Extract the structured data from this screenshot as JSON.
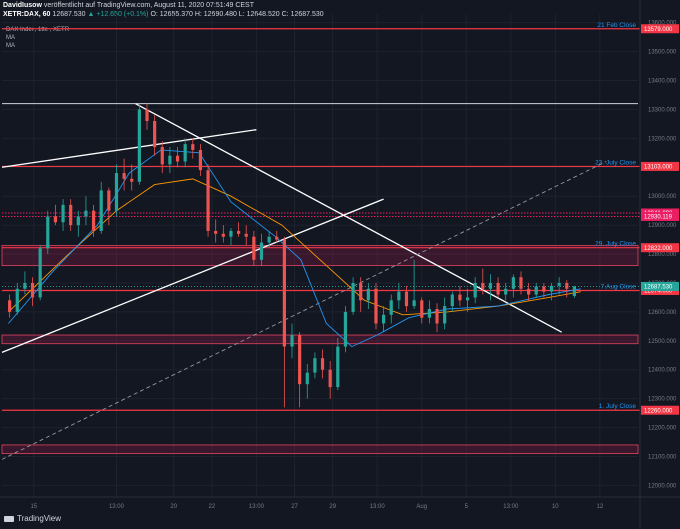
{
  "header": {
    "author": "DavidIusow",
    "published": "veröffentlicht auf TradingView.com, August 11, 2020 07:51:49 CEST",
    "symbol": "XETR:DAX, 60",
    "last": "12687.530",
    "change": "▲ +12.650 (+0.1%)",
    "ohlc": "O: 12655.370 H: 12690.480 L: 12648.520 C: 12687.530"
  },
  "legend": {
    "title": "DAX Index, 1tte , XETR",
    "ma1": "MA",
    "ma2": "MA"
  },
  "branding": {
    "name": "TradingView"
  },
  "chart_data": {
    "type": "candlestick",
    "ylim": [
      11960,
      13630
    ],
    "y_ticks": [
      12000,
      12100,
      12200,
      12300,
      12400,
      12500,
      12600,
      12700,
      12800,
      12900,
      13000,
      13100,
      13200,
      13300,
      13400,
      13500,
      13600
    ],
    "y_tick_labels": [
      "12000.000",
      "12100.000",
      "12200.000",
      "12300.000",
      "12400.000",
      "12500.000",
      "12600.000",
      "12700.000",
      "12800.000",
      "12900.000",
      "13000.000",
      "13100.000",
      "13200.000",
      "13300.000",
      "13400.000",
      "13500.000",
      "13600.000"
    ],
    "xlim": [
      0,
      100
    ],
    "x_ticks": [
      5,
      18,
      27,
      33,
      40,
      46,
      52,
      59,
      66,
      73,
      80,
      87,
      94
    ],
    "x_tick_labels": [
      "15",
      "13:00",
      "20",
      "22",
      "13:00",
      "27",
      "29",
      "13:00",
      "Aug",
      "5",
      "13:00",
      "10",
      "12"
    ],
    "bars_x": [
      1.2,
      2.4,
      3.6,
      4.8,
      6,
      7.2,
      8.4,
      9.6,
      10.8,
      12,
      13.2,
      14.4,
      15.6,
      16.8,
      18,
      19.2,
      20.4,
      21.6,
      22.8,
      24,
      25.2,
      26.4,
      27.6,
      28.8,
      30,
      31.2,
      32.4,
      33.6,
      34.8,
      36,
      37.2,
      38.4,
      39.6,
      40.8,
      42,
      43.2,
      44.4,
      45.6,
      46.8,
      48,
      49.2,
      50.4,
      51.6,
      52.8,
      54,
      55.2,
      56.4,
      57.6,
      58.8,
      60,
      61.2,
      62.4,
      63.6,
      64.8,
      66,
      67.2,
      68.4,
      69.6,
      70.8,
      72,
      73.2,
      74.4,
      75.6,
      76.8,
      78,
      79.2,
      80.4,
      81.6,
      82.8,
      84,
      85.2,
      86.4,
      87.6,
      88.8,
      90,
      91.2
    ],
    "ohlc": [
      [
        12640,
        12660,
        12580,
        12600
      ],
      [
        12600,
        12700,
        12590,
        12680
      ],
      [
        12680,
        12740,
        12660,
        12700
      ],
      [
        12700,
        12720,
        12620,
        12650
      ],
      [
        12650,
        12830,
        12640,
        12820
      ],
      [
        12820,
        12950,
        12800,
        12930
      ],
      [
        12930,
        12970,
        12900,
        12910
      ],
      [
        12910,
        12990,
        12880,
        12970
      ],
      [
        12970,
        12990,
        12880,
        12900
      ],
      [
        12900,
        12950,
        12860,
        12930
      ],
      [
        12930,
        13000,
        12900,
        12950
      ],
      [
        12950,
        12970,
        12860,
        12880
      ],
      [
        12880,
        13050,
        12870,
        13020
      ],
      [
        13020,
        13030,
        12900,
        12950
      ],
      [
        12950,
        13110,
        12930,
        13080
      ],
      [
        13080,
        13130,
        13020,
        13060
      ],
      [
        13060,
        13110,
        13020,
        13050
      ],
      [
        13050,
        13320,
        13040,
        13300
      ],
      [
        13300,
        13320,
        13230,
        13260
      ],
      [
        13260,
        13280,
        13140,
        13170
      ],
      [
        13170,
        13190,
        13080,
        13110
      ],
      [
        13110,
        13170,
        13080,
        13140
      ],
      [
        13140,
        13170,
        13100,
        13120
      ],
      [
        13120,
        13200,
        13100,
        13180
      ],
      [
        13180,
        13200,
        13130,
        13160
      ],
      [
        13160,
        13180,
        13070,
        13090
      ],
      [
        13090,
        13110,
        12860,
        12880
      ],
      [
        12880,
        12920,
        12840,
        12870
      ],
      [
        12870,
        12900,
        12840,
        12860
      ],
      [
        12860,
        12890,
        12830,
        12880
      ],
      [
        12880,
        12910,
        12860,
        12870
      ],
      [
        12870,
        12900,
        12830,
        12860
      ],
      [
        12860,
        12880,
        12760,
        12780
      ],
      [
        12780,
        12870,
        12760,
        12840
      ],
      [
        12840,
        12880,
        12820,
        12860
      ],
      [
        12860,
        12880,
        12840,
        12850
      ],
      [
        12850,
        12860,
        12270,
        12480
      ],
      [
        12480,
        12560,
        12440,
        12520
      ],
      [
        12520,
        12530,
        12270,
        12350
      ],
      [
        12350,
        12420,
        12300,
        12390
      ],
      [
        12390,
        12460,
        12370,
        12440
      ],
      [
        12440,
        12470,
        12370,
        12400
      ],
      [
        12400,
        12430,
        12300,
        12340
      ],
      [
        12340,
        12510,
        12330,
        12480
      ],
      [
        12480,
        12620,
        12460,
        12600
      ],
      [
        12600,
        12720,
        12590,
        12700
      ],
      [
        12700,
        12720,
        12600,
        12640
      ],
      [
        12640,
        12700,
        12610,
        12680
      ],
      [
        12680,
        12700,
        12540,
        12560
      ],
      [
        12560,
        12620,
        12530,
        12590
      ],
      [
        12590,
        12660,
        12560,
        12640
      ],
      [
        12640,
        12700,
        12610,
        12670
      ],
      [
        12670,
        12690,
        12600,
        12620
      ],
      [
        12620,
        12780,
        12610,
        12640
      ],
      [
        12640,
        12650,
        12560,
        12580
      ],
      [
        12580,
        12640,
        12560,
        12610
      ],
      [
        12610,
        12630,
        12530,
        12560
      ],
      [
        12560,
        12650,
        12540,
        12620
      ],
      [
        12620,
        12670,
        12600,
        12660
      ],
      [
        12660,
        12690,
        12620,
        12640
      ],
      [
        12640,
        12680,
        12600,
        12650
      ],
      [
        12650,
        12720,
        12630,
        12700
      ],
      [
        12700,
        12750,
        12660,
        12680
      ],
      [
        12680,
        12730,
        12640,
        12700
      ],
      [
        12700,
        12720,
        12650,
        12660
      ],
      [
        12660,
        12700,
        12640,
        12680
      ],
      [
        12680,
        12730,
        12650,
        12720
      ],
      [
        12720,
        12740,
        12660,
        12680
      ],
      [
        12680,
        12700,
        12640,
        12660
      ],
      [
        12660,
        12700,
        12648,
        12688
      ],
      [
        12688,
        12700,
        12650,
        12670
      ],
      [
        12670,
        12700,
        12640,
        12690
      ],
      [
        12690,
        12720,
        12660,
        12700
      ],
      [
        12700,
        12710,
        12650,
        12680
      ],
      [
        12655,
        12690,
        12648,
        12688
      ]
    ],
    "ma_fast": [
      [
        1,
        12560
      ],
      [
        8,
        12740
      ],
      [
        15,
        12900
      ],
      [
        20,
        13080
      ],
      [
        25,
        13160
      ],
      [
        31,
        13150
      ],
      [
        36,
        12980
      ],
      [
        43,
        12860
      ],
      [
        47,
        12780
      ],
      [
        51,
        12560
      ],
      [
        55,
        12480
      ],
      [
        59,
        12520
      ],
      [
        64,
        12580
      ],
      [
        70,
        12610
      ],
      [
        78,
        12620
      ],
      [
        86,
        12660
      ],
      [
        91,
        12680
      ]
    ],
    "ma_slow": [
      [
        1,
        12600
      ],
      [
        10,
        12790
      ],
      [
        18,
        12950
      ],
      [
        24,
        13040
      ],
      [
        30,
        13060
      ],
      [
        36,
        13000
      ],
      [
        44,
        12900
      ],
      [
        51,
        12760
      ],
      [
        57,
        12640
      ],
      [
        63,
        12590
      ],
      [
        70,
        12600
      ],
      [
        78,
        12620
      ],
      [
        86,
        12650
      ],
      [
        91,
        12670
      ]
    ],
    "levels": [
      {
        "value": 13579,
        "label": "21 Feb Close",
        "price": "13579.000"
      },
      {
        "value": 13103,
        "label": "23. July Close",
        "price": "13103.000"
      },
      {
        "value": 12822,
        "label": "29. July Close",
        "price": "12822.000"
      },
      {
        "value": 12674,
        "label": "7.Aug Close",
        "price": "12674.000"
      },
      {
        "value": 12260,
        "label": "1. July Close",
        "price": "12260.000"
      }
    ],
    "dotted_levels": [
      {
        "value": 12942,
        "price": "12941.892"
      },
      {
        "value": 12930,
        "price": "12930.119"
      }
    ],
    "last_price": {
      "value": 12688,
      "price": "12687.530"
    },
    "zones": [
      [
        12760,
        12830
      ],
      [
        12490,
        12520
      ],
      [
        12110,
        12140
      ]
    ],
    "white_hline": 13320,
    "trendlines": [
      {
        "from": [
          0,
          13100
        ],
        "to": [
          40,
          13230
        ],
        "style": "solid"
      },
      {
        "from": [
          0,
          12460
        ],
        "to": [
          60,
          12990
        ],
        "style": "solid"
      },
      {
        "from": [
          21,
          13320
        ],
        "to": [
          88,
          12530
        ],
        "style": "solid"
      },
      {
        "from": [
          0,
          12090
        ],
        "to": [
          95,
          13120
        ],
        "style": "dashed"
      }
    ]
  }
}
